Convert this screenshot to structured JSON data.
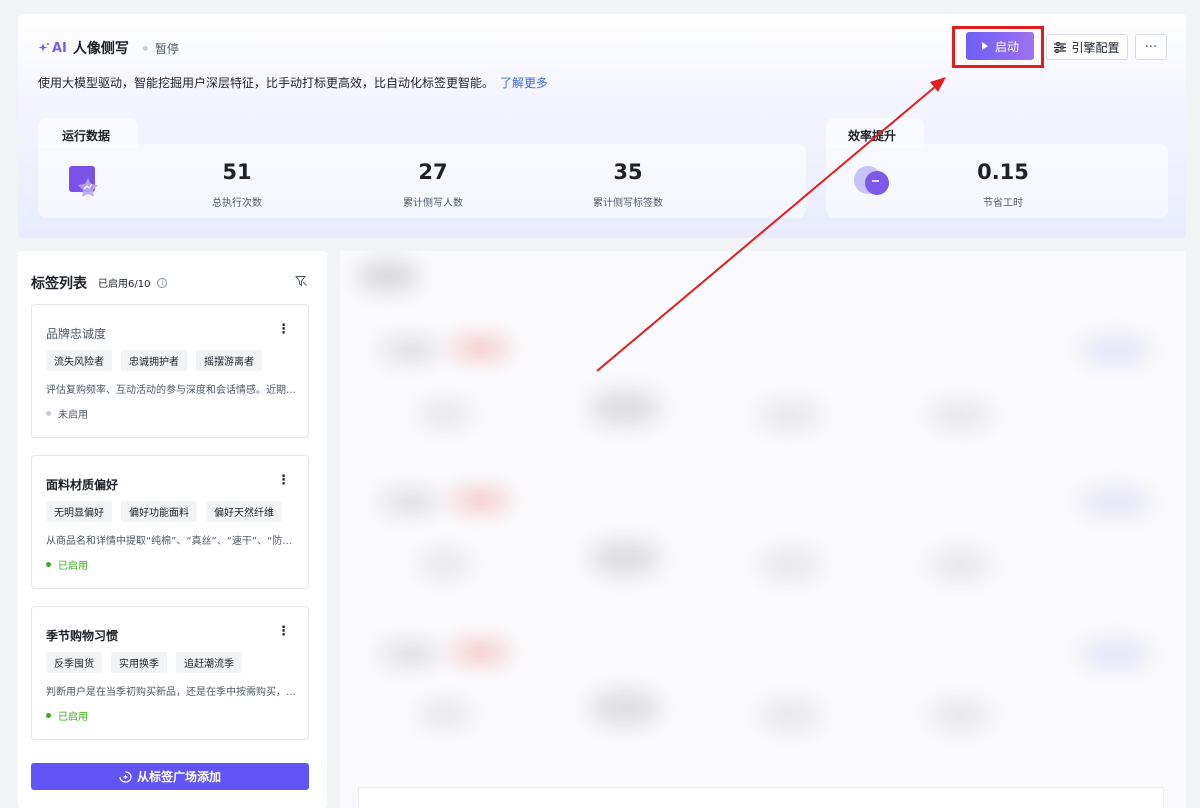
{
  "header": {
    "ai_label": "AI",
    "title": "人像侧写",
    "status": "暂停",
    "description": "使用大模型驱动，智能挖掘用户深层特征，比手动打标更高效，比自动化标签更智能。",
    "learn_more": "了解更多",
    "start_button": "启动",
    "engine_button": "引擎配置",
    "more_button": "···"
  },
  "run_data": {
    "tab_label": "运行数据",
    "metrics": [
      {
        "value": "51",
        "label": "总执行次数"
      },
      {
        "value": "27",
        "label": "累计侧写人数"
      },
      {
        "value": "35",
        "label": "累计侧写标签数"
      }
    ]
  },
  "efficiency": {
    "tab_label": "效率提升",
    "metrics": [
      {
        "value": "0.15",
        "label": "节省工时"
      }
    ]
  },
  "sidebar": {
    "title": "标签列表",
    "count": "已启用6/10",
    "cards": [
      {
        "name": "品牌忠诚度",
        "tags": [
          "流失风险者",
          "忠诚拥护者",
          "摇摆游离者"
        ],
        "description": "评估复购频率、互动活动的参与深度和会话情感。近期…",
        "status": "未启用"
      },
      {
        "name": "面料材质偏好",
        "tags": [
          "无明显偏好",
          "偏好功能面料",
          "偏好天然纤维"
        ],
        "description": "从商品名和详情中提取“纯棉”、“真丝”、“速干”、“防水…",
        "status": "已启用"
      },
      {
        "name": "季节购物习惯",
        "tags": [
          "反季囤货",
          "实用换季",
          "追赶潮流季"
        ],
        "description": "判断用户是在当季初购买新品，还是在季中按需购买，…",
        "status": "已启用"
      }
    ],
    "add_button": "从标签广场添加"
  },
  "colors": {
    "accent": "#6155f5",
    "enabled": "#3aab1f",
    "annotation": "#e31d1d"
  }
}
